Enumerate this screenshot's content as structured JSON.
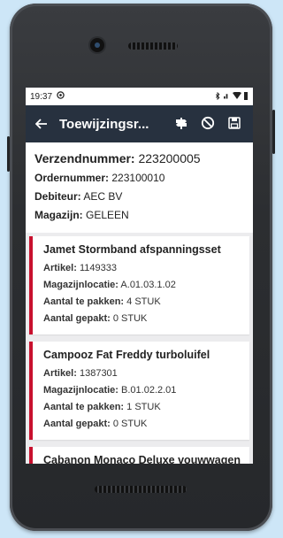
{
  "status_bar": {
    "time": "19:37",
    "right_icons": "✲ ▾ ▌"
  },
  "app_bar": {
    "title": "Toewijzingsr...",
    "icons": [
      "back-arrow-icon",
      "signpost-icon",
      "block-icon",
      "save-icon"
    ]
  },
  "order": {
    "shipment_label": "Verzendnummer:",
    "shipment_value": "223200005",
    "order_label": "Ordernummer:",
    "order_value": "223100010",
    "debtor_label": "Debiteur:",
    "debtor_value": "AEC BV",
    "warehouse_label": "Magazijn:",
    "warehouse_value": "GELEEN"
  },
  "items": [
    {
      "name": "Jamet Stormband afspanningsset",
      "article_label": "Artikel:",
      "article": "1149333",
      "location_label": "Magazijnlocatie:",
      "location": "A.01.03.1.02",
      "to_pick_label": "Aantal te pakken:",
      "to_pick": "4 STUK",
      "picked_label": "Aantal gepakt:",
      "picked": "0 STUK"
    },
    {
      "name": "Campooz Fat Freddy turboluifel",
      "article_label": "Artikel:",
      "article": "1387301",
      "location_label": "Magazijnlocatie:",
      "location": "B.01.02.2.01",
      "to_pick_label": "Aantal te pakken:",
      "to_pick": "1 STUK",
      "picked_label": "Aantal gepakt:",
      "picked": "0 STUK"
    },
    {
      "name": "Cabanon Monaco Deluxe vouwwagen"
    }
  ]
}
